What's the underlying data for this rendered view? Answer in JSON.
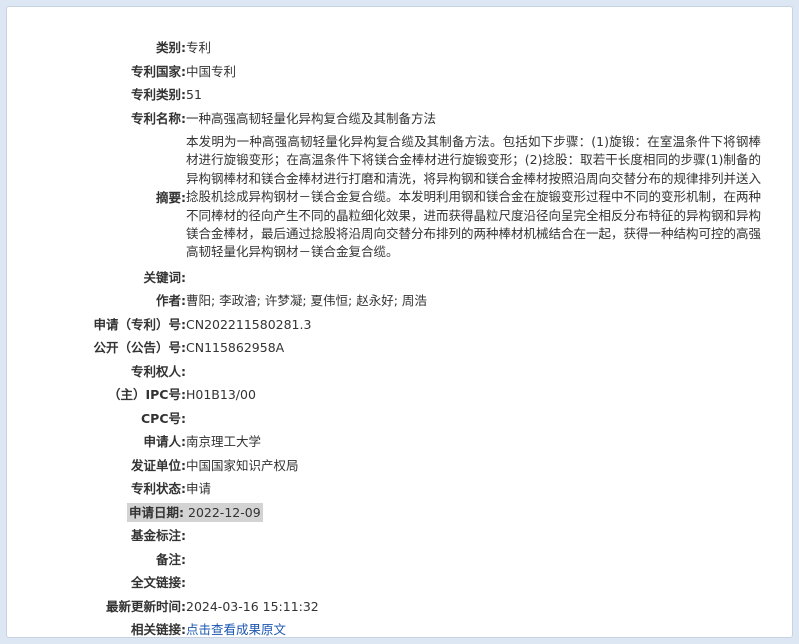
{
  "rows": [
    {
      "label": "类别:",
      "value": "专利"
    },
    {
      "label": "专利国家:",
      "value": "中国专利"
    },
    {
      "label": "专利类别:",
      "value": "51"
    },
    {
      "label": "专利名称:",
      "value": "一种高强高韧轻量化异构复合缆及其制备方法"
    },
    {
      "label": "摘要:",
      "value": "本发明为一种高强高韧轻量化异构复合缆及其制备方法。包括如下步骤：(1)旋锻：在室温条件下将钢棒材进行旋锻变形；在高温条件下将镁合金棒材进行旋锻变形；(2)捻股：取若干长度相同的步骤(1)制备的异构钢棒材和镁合金棒材进行打磨和清洗，将异构钢和镁合金棒材按照沿周向交替分布的规律排列并送入捻股机捻成异构钢材－镁合金复合缆。本发明利用钢和镁合金在旋锻变形过程中不同的变形机制，在两种不同棒材的径向产生不同的晶粒细化效果，进而获得晶粒尺度沿径向呈完全相反分布特征的异构钢和异构镁合金棒材，最后通过捻股将沿周向交替分布排列的两种棒材机械结合在一起，获得一种结构可控的高强高韧轻量化异构钢材－镁合金复合缆。"
    },
    {
      "label": "关键词:",
      "value": ""
    },
    {
      "label": "作者:",
      "value": "曹阳; 李政濬; 许梦凝; 夏伟恒; 赵永好; 周浩"
    },
    {
      "label": "申请（专利）号:",
      "value": "CN202211580281.3"
    },
    {
      "label": "公开（公告）号:",
      "value": "CN115862958A"
    },
    {
      "label": "专利权人:",
      "value": ""
    },
    {
      "label": "（主）IPC号:",
      "value": "H01B13/00"
    },
    {
      "label": "CPC号:",
      "value": ""
    },
    {
      "label": "申请人:",
      "value": "南京理工大学"
    },
    {
      "label": "发证单位:",
      "value": "中国国家知识产权局"
    },
    {
      "label": "专利状态:",
      "value": "申请"
    },
    {
      "label": "申请日期:",
      "value": "2022-12-09"
    },
    {
      "label": "基金标注:",
      "value": ""
    },
    {
      "label": "备注:",
      "value": ""
    },
    {
      "label": "全文链接:",
      "value": ""
    },
    {
      "label": "最新更新时间:",
      "value": "2024-03-16 15:11:32"
    },
    {
      "label": "相关链接:",
      "value": "点击查看成果原文"
    }
  ],
  "colors": {
    "link": "#1a56b0",
    "highlight": "#d3d3d3",
    "background": "#dde7f3"
  }
}
